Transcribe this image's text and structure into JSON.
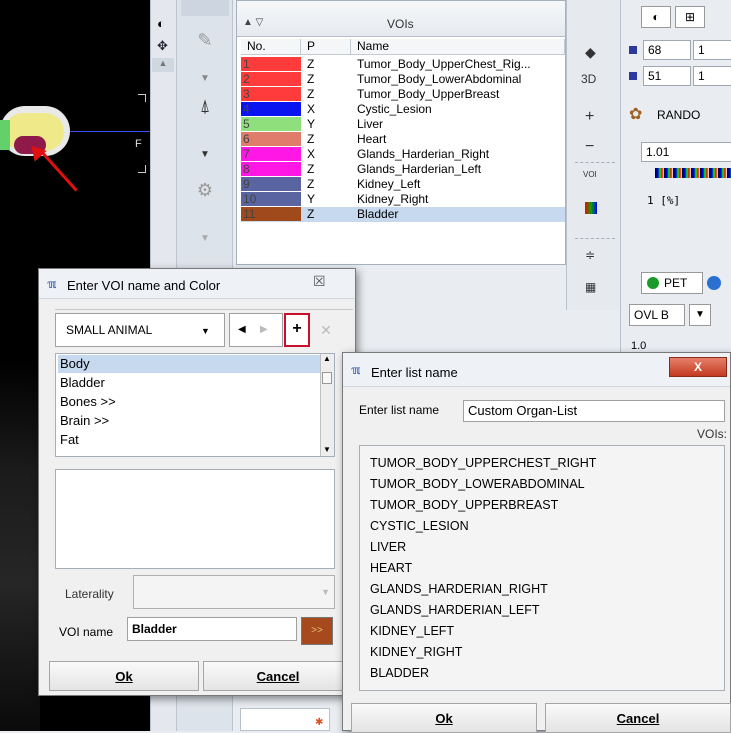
{
  "viewer": {
    "orientation_label": "F"
  },
  "voi_panel": {
    "title": "VOIs",
    "columns": [
      "No.",
      "P",
      "Name"
    ],
    "rows": [
      {
        "no": "1",
        "p": "Z",
        "name": "Tumor_Body_UpperChest_Rig...",
        "color": "#ff3b3b"
      },
      {
        "no": "2",
        "p": "Z",
        "name": "Tumor_Body_LowerAbdominal",
        "color": "#ff3b3b"
      },
      {
        "no": "3",
        "p": "Z",
        "name": "Tumor_Body_UpperBreast",
        "color": "#ff3b3b"
      },
      {
        "no": "4",
        "p": "X",
        "name": "Cystic_Lesion",
        "color": "#0a14f0"
      },
      {
        "no": "5",
        "p": "Y",
        "name": "Liver",
        "color": "#8fe07c"
      },
      {
        "no": "6",
        "p": "Z",
        "name": "Heart",
        "color": "#e07c6c"
      },
      {
        "no": "7",
        "p": "X",
        "name": "Glands_Harderian_Right",
        "color": "#ff17e6"
      },
      {
        "no": "8",
        "p": "Z",
        "name": "Glands_Harderian_Left",
        "color": "#ff17e6"
      },
      {
        "no": "9",
        "p": "Z",
        "name": "Kidney_Left",
        "color": "#5a64a0"
      },
      {
        "no": "10",
        "p": "Y",
        "name": "Kidney_Right",
        "color": "#5a64a0"
      },
      {
        "no": "11",
        "p": "Z",
        "name": "Bladder",
        "color": "#a04a1c"
      }
    ]
  },
  "side_col": {
    "btn_3d": "3D",
    "btn_plus": "+",
    "btn_minus": "−",
    "voi_label": "VOI"
  },
  "right_panel": {
    "field1": "68",
    "field1b": "1",
    "field2": "51",
    "field2b": "1",
    "rando": "RANDO",
    "value": "1.01",
    "unit": "1 [%]",
    "pet_tab": "PET",
    "ovl": "OVL B",
    "small": "1.0"
  },
  "voi_dialog": {
    "title": "Enter VOI name and Color",
    "category": "SMALL ANIMAL",
    "list": [
      "Body",
      "Bladder",
      "Bones >>",
      "Brain >>",
      "Fat"
    ],
    "laterality_label": "Laterality",
    "voi_name_label": "VOI name",
    "voi_name_value": "Bladder",
    "color_btn": ">>",
    "ok": "Ok",
    "cancel": "Cancel",
    "swatch_color": "#a64a1e"
  },
  "list_dialog": {
    "title": "Enter list name",
    "label": "Enter list name",
    "value": "Custom Organ-List",
    "vois_label": "VOIs:",
    "items": [
      "TUMOR_BODY_UPPERCHEST_RIGHT",
      "TUMOR_BODY_LOWERABDOMINAL",
      "TUMOR_BODY_UPPERBREAST",
      "CYSTIC_LESION",
      "LIVER",
      "HEART",
      "GLANDS_HARDERIAN_RIGHT",
      "GLANDS_HARDERIAN_LEFT",
      "KIDNEY_LEFT",
      "KIDNEY_RIGHT",
      "BLADDER"
    ],
    "ok": "Ok",
    "cancel": "Cancel",
    "close": "X"
  }
}
